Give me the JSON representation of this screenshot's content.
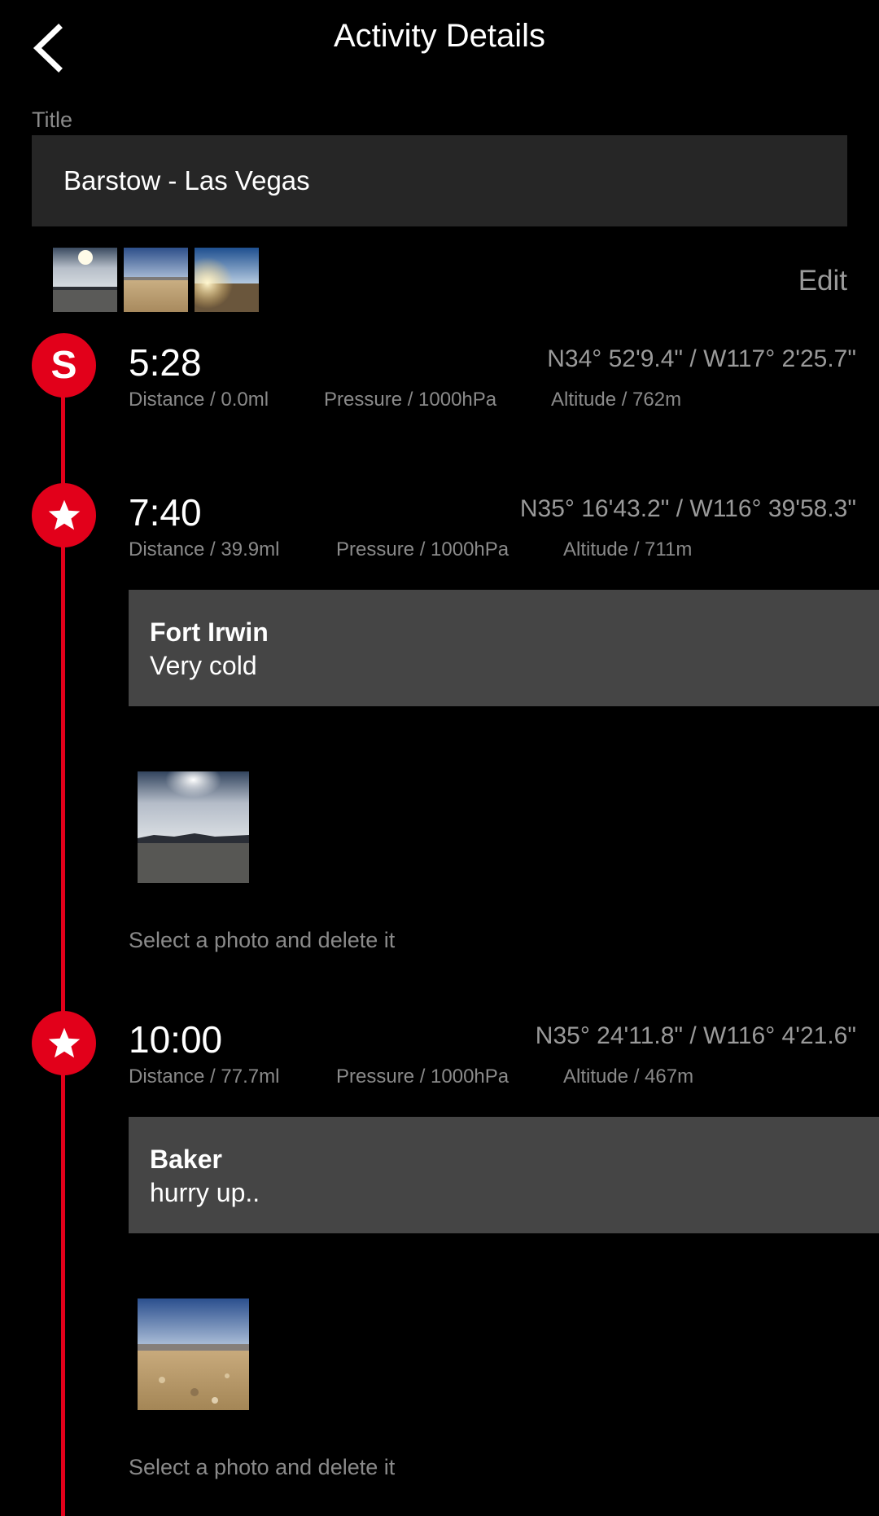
{
  "header": {
    "title": "Activity Details"
  },
  "title_section": {
    "label": "Title",
    "value": "Barstow - Las Vegas"
  },
  "edit_label": "Edit",
  "entries": [
    {
      "marker": "S",
      "time": "5:28",
      "coords": "N34° 52'9.4\" / W117° 2'25.7\"",
      "distance": "Distance / 0.0ml",
      "pressure": "Pressure / 1000hPa",
      "altitude": "Altitude / 762m"
    },
    {
      "marker": "star",
      "time": "7:40",
      "coords": "N35° 16'43.2\" / W116° 39'58.3\"",
      "distance": "Distance / 39.9ml",
      "pressure": "Pressure / 1000hPa",
      "altitude": "Altitude / 711m",
      "note_title": "Fort Irwin",
      "note_text": "Very cold",
      "hint": "Select a photo and delete it"
    },
    {
      "marker": "star",
      "time": "10:00",
      "coords": "N35° 24'11.8\" / W116° 4'21.6\"",
      "distance": "Distance / 77.7ml",
      "pressure": "Pressure / 1000hPa",
      "altitude": "Altitude / 467m",
      "note_title": "Baker",
      "note_text": "hurry up..",
      "hint": "Select a photo and delete it"
    }
  ],
  "colors": {
    "accent": "#e2001a",
    "background": "#000000",
    "field": "#262626",
    "note": "#454545"
  }
}
